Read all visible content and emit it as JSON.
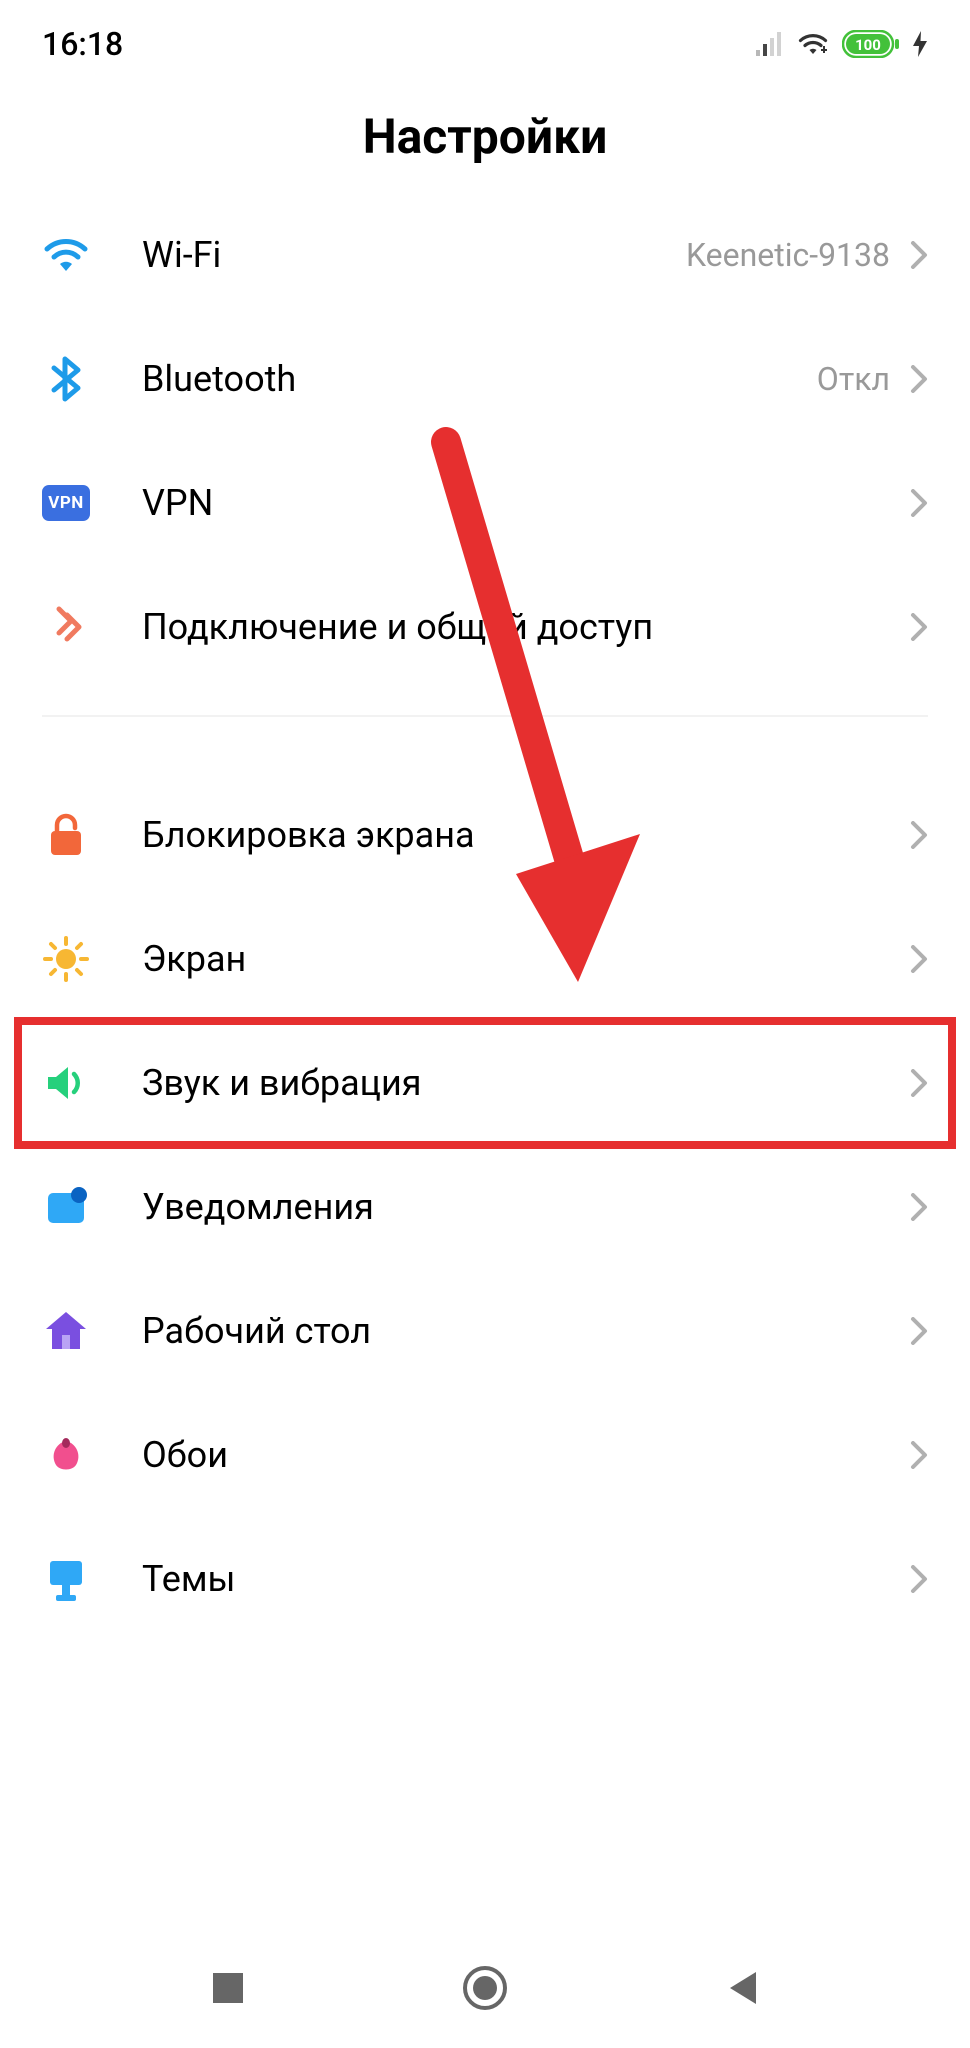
{
  "status": {
    "time": "16:18",
    "battery": "100"
  },
  "page_title": "Настройки",
  "group1": {
    "wifi": {
      "label": "Wi-Fi",
      "value": "Keenetic-9138"
    },
    "bluetooth": {
      "label": "Bluetooth",
      "value": "Откл"
    },
    "vpn": {
      "label": "VPN"
    },
    "share": {
      "label": "Подключение и общий доступ"
    }
  },
  "group2": {
    "lock": {
      "label": "Блокировка экрана"
    },
    "display": {
      "label": "Экран"
    },
    "sound": {
      "label": "Звук и вибрация"
    },
    "notif": {
      "label": "Уведомления"
    },
    "home": {
      "label": "Рабочий стол"
    },
    "wallpaper": {
      "label": "Обои"
    },
    "themes": {
      "label": "Темы"
    }
  },
  "badges": {
    "vpn": "VPN"
  },
  "annotation": {
    "highlighted_item": "sound"
  }
}
